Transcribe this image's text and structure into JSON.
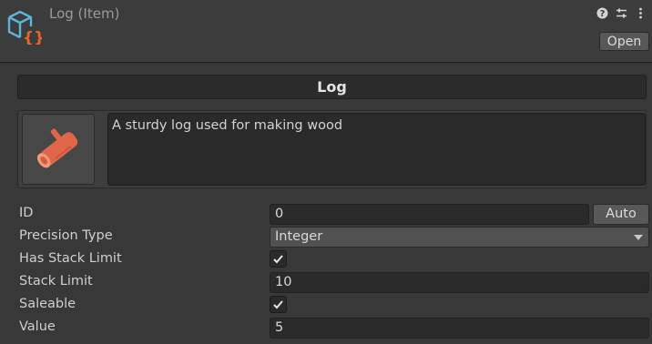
{
  "header": {
    "title": "Log (Item)",
    "open_label": "Open",
    "icons": [
      "scriptable-object-icon",
      "help-icon",
      "settings-sliders-icon",
      "more-menu-icon"
    ]
  },
  "item": {
    "name": "Log",
    "description": "A sturdy log used for making wood",
    "icon": "log-icon"
  },
  "fields": {
    "id": {
      "label": "ID",
      "value": "0",
      "auto_label": "Auto"
    },
    "precision_type": {
      "label": "Precision Type",
      "value": "Integer"
    },
    "has_stack_limit": {
      "label": "Has Stack Limit",
      "checked": true
    },
    "stack_limit": {
      "label": "Stack Limit",
      "value": "10"
    },
    "saleable": {
      "label": "Saleable",
      "checked": true
    },
    "value": {
      "label": "Value",
      "value": "5"
    }
  },
  "colors": {
    "background": "#383838",
    "field": "#2a2a2a",
    "icon_blue": "#5fb3d9",
    "icon_orange": "#e8632c",
    "log_orange": "#e0664a"
  }
}
